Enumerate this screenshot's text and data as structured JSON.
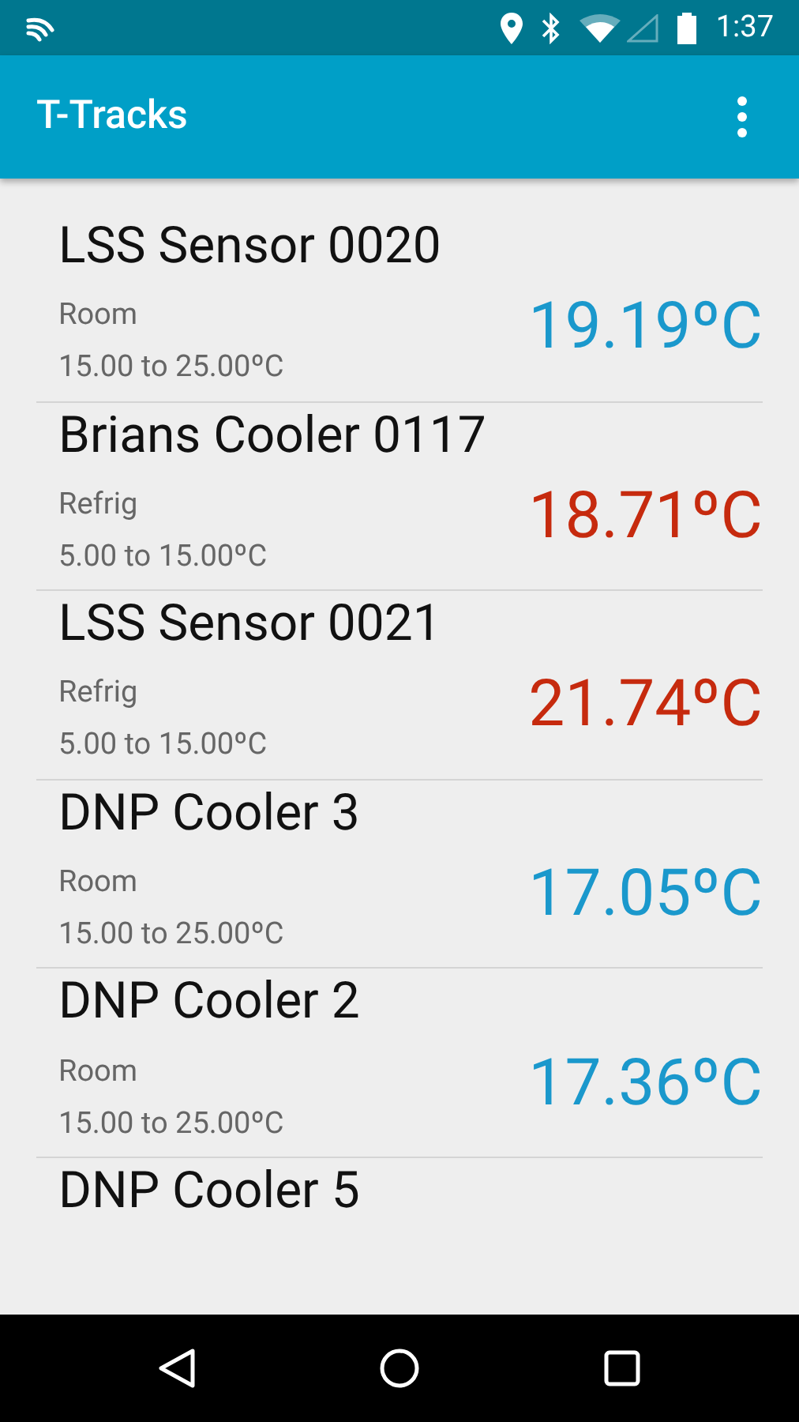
{
  "status_bar": {
    "time": "1:37"
  },
  "app_bar": {
    "title": "T-Tracks"
  },
  "sensors": [
    {
      "name": "LSS Sensor 0020",
      "type": "Room",
      "range": "15.00 to 25.00ºC",
      "reading": "19.19ºC",
      "color": "#1a98cc"
    },
    {
      "name": "Brians Cooler 0117",
      "type": "Refrig",
      "range": "5.00 to 15.00ºC",
      "reading": "18.71ºC",
      "color": "#c62a0e"
    },
    {
      "name": "LSS Sensor 0021",
      "type": "Refrig",
      "range": "5.00 to 15.00ºC",
      "reading": "21.74ºC",
      "color": "#c62a0e"
    },
    {
      "name": "DNP Cooler 3",
      "type": "Room",
      "range": "15.00 to 25.00ºC",
      "reading": "17.05ºC",
      "color": "#1a98cc"
    },
    {
      "name": "DNP Cooler 2",
      "type": "Room",
      "range": "15.00 to 25.00ºC",
      "reading": "17.36ºC",
      "color": "#1a98cc"
    },
    {
      "name": "DNP Cooler 5"
    }
  ]
}
